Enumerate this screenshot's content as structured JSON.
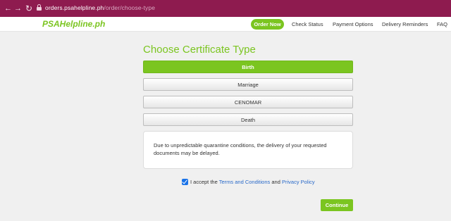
{
  "browser": {
    "url_host": "orders.psahelpline.ph",
    "url_path": "/order/choose-type"
  },
  "header": {
    "logo": "PSAHelpline.ph",
    "order_now": "Order Now",
    "nav": [
      "Check Status",
      "Payment Options",
      "Delivery Reminders",
      "FAQ"
    ]
  },
  "main": {
    "title": "Choose Certificate Type",
    "options": [
      {
        "label": "Birth",
        "selected": true
      },
      {
        "label": "Marriage",
        "selected": false
      },
      {
        "label": "CENOMAR",
        "selected": false
      },
      {
        "label": "Death",
        "selected": false
      }
    ],
    "notice": "Due to unpredictable quarantine conditions, the delivery of your requested documents may be delayed.",
    "accept": {
      "checked": true,
      "prefix": "I accept the",
      "terms": "Terms and Conditions",
      "and": "and",
      "privacy": "Privacy Policy"
    },
    "continue": "Continue"
  },
  "colors": {
    "brand_green": "#7bc520",
    "browser_bar": "#8e1b4f",
    "link_blue": "#2a6ac9",
    "checkbox_blue": "#1a73e8"
  },
  "icons": [
    "back-arrow-icon",
    "forward-arrow-icon",
    "reload-icon",
    "lock-icon",
    "checkmark-icon"
  ]
}
